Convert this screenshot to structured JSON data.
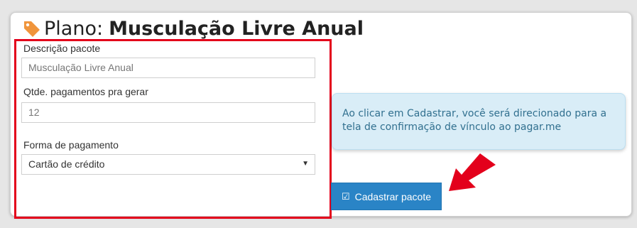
{
  "page": {
    "title_prefix": "Plano:",
    "title_name": "Musculação Livre Anual"
  },
  "form": {
    "description_label": "Descrição pacote",
    "description_value": "Musculação Livre Anual",
    "payments_label": "Qtde. pagamentos pra gerar",
    "payments_value": "12",
    "payment_method_label": "Forma de pagamento",
    "payment_method_value": "Cartão de crédito"
  },
  "info_box": {
    "text": "Ao clicar em Cadastrar, você será direcionado para a tela de confirmação de vínculo ao pagar.me"
  },
  "actions": {
    "submit_label": "Cadastrar pacote"
  },
  "icons": {
    "title_icon": "tag-icon",
    "button_icon": "check-square-icon",
    "annotation_arrow": "arrow-icon"
  },
  "colors": {
    "accent": "#2a84c6",
    "highlight_border": "#e3001b",
    "info_bg": "#d9edf7",
    "info_text": "#31708f",
    "tag_icon": "#f0953c"
  }
}
